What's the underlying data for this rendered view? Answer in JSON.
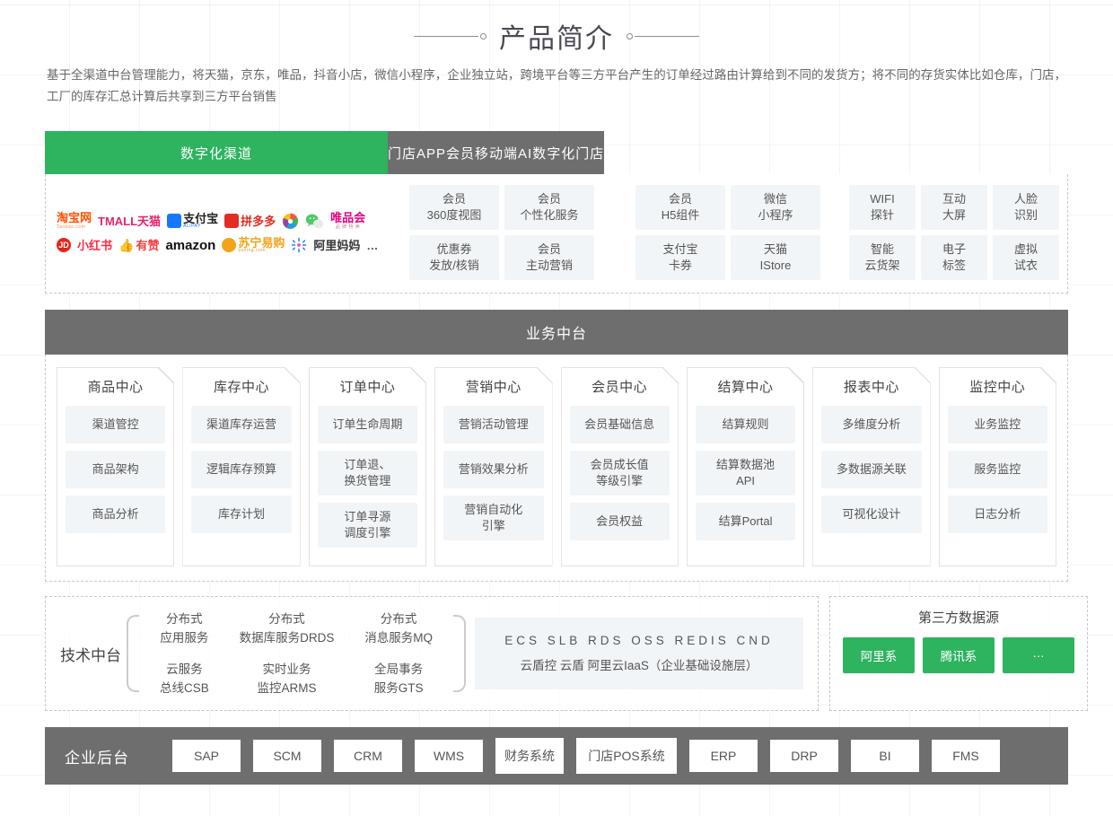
{
  "page": {
    "title": "产品简介",
    "description": "基于全渠道中台管理能力，将天猫，京东，唯品，抖音小店，微信小程序，企业独立站，跨境平台等三方平台产生的订单经过路由计算给到不同的发货方；将不同的存货实体比如仓库，门店，工厂的库存汇总计算后共享到三方平台销售"
  },
  "colors": {
    "green": "#2eb35f",
    "gray": "#6e6e6e",
    "cell": "#f2f5f7"
  },
  "channel": {
    "tabs": [
      {
        "label": "数字化渠道",
        "style": "green"
      },
      {
        "label": "门店APP",
        "style": "gray"
      },
      {
        "label": "会员移动端",
        "style": "gray"
      },
      {
        "label": "AI数字化门店",
        "style": "gray"
      }
    ],
    "logos_row1": [
      "淘宝网",
      "TMALL天猫",
      "支付宝",
      "拼多多",
      "抖音",
      "微信",
      "唯品会"
    ],
    "logos_row2": [
      "JD",
      "小红书",
      "有赞",
      "amazon",
      "苏宁易购",
      "阿里妈妈",
      "…"
    ],
    "logo_subs": {
      "taobao": "Taobao.com",
      "alipay": "ALIPAY",
      "suning": "suning.com",
      "vip": "品 牌 特 卖"
    },
    "store_app": [
      "会员\n360度视图",
      "会员\n个性化服务",
      "优惠券\n发放/核销",
      "会员\n主动营销"
    ],
    "member_mobile": [
      "会员\nH5组件",
      "微信\n小程序",
      "支付宝\n卡券",
      "天猫\nIStore"
    ],
    "ai_store": [
      "WIFI\n探针",
      "互动\n大屏",
      "人脸\n识别",
      "智能\n云货架",
      "电子\n标签",
      "虚拟\n试衣"
    ]
  },
  "business": {
    "header": "业务中台",
    "cards": [
      {
        "title": "商品中心",
        "items": [
          "渠道管控",
          "商品架构",
          "商品分析"
        ]
      },
      {
        "title": "库存中心",
        "items": [
          "渠道库存运营",
          "逻辑库存预算",
          "库存计划"
        ]
      },
      {
        "title": "订单中心",
        "items": [
          "订单生命周期",
          "订单退、\n换货管理",
          "订单寻源\n调度引擎"
        ]
      },
      {
        "title": "营销中心",
        "items": [
          "营销活动管理",
          "营销效果分析",
          "营销自动化\n引擎"
        ]
      },
      {
        "title": "会员中心",
        "items": [
          "会员基础信息",
          "会员成长值\n等级引擎",
          "会员权益"
        ]
      },
      {
        "title": "结算中心",
        "items": [
          "结算规则",
          "结算数据池\nAPI",
          "结算Portal"
        ]
      },
      {
        "title": "报表中心",
        "items": [
          "多维度分析",
          "多数据源关联",
          "可视化设计"
        ]
      },
      {
        "title": "监控中心",
        "items": [
          "业务监控",
          "服务监控",
          "日志分析"
        ]
      }
    ]
  },
  "tech": {
    "label": "技术中台",
    "columns": [
      {
        "top": "分布式\n应用服务",
        "bottom": "云服务\n总线CSB"
      },
      {
        "top": "分布式\n数据库服务DRDS",
        "bottom": "实时业务\n监控ARMS"
      },
      {
        "top": "分布式\n消息服务MQ",
        "bottom": "全局事务\n服务GTS"
      }
    ],
    "cloud_row1": "ECS  SLB  RDS  OSS  REDIS  CND",
    "cloud_row2": "云盾控  云盾  阿里云IaaS（企业基础设施层）"
  },
  "third_party": {
    "title": "第三方数据源",
    "buttons": [
      "阿里系",
      "腾讯系",
      "…"
    ]
  },
  "enterprise": {
    "title": "企业后台",
    "systems": [
      "SAP",
      "SCM",
      "CRM",
      "WMS",
      "财务系统",
      "门店POS系统",
      "ERP",
      "DRP",
      "BI",
      "FMS"
    ]
  }
}
